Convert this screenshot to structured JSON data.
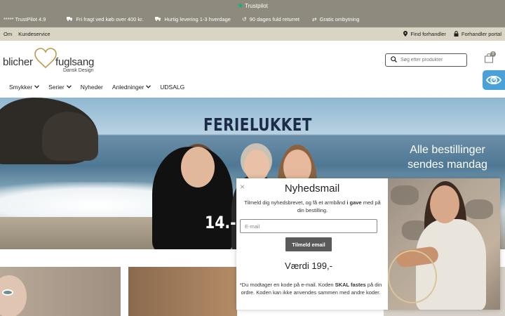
{
  "topbar": {
    "brand": "Trustpilot",
    "star_icon": "star-icon",
    "brand_color": "#00b67a"
  },
  "usp": [
    {
      "icon": "stars",
      "label": "***** TrustPilot 4.9"
    },
    {
      "icon": "truck-icon",
      "label": "Fri fragt ved køb over 400 kr."
    },
    {
      "icon": "delivery-truck-icon",
      "label": "Hurtig levering 1-3 hverdage"
    },
    {
      "icon": "return-icon",
      "label": "90 dages fuld returret"
    },
    {
      "icon": "exchange-icon",
      "label": "Gratis ombytning"
    }
  ],
  "utility": {
    "left": [
      "Om",
      "Kundeservice"
    ],
    "find_dealer": "Find forhandler",
    "dealer_portal": "Forhandler portal"
  },
  "logo": {
    "word1": "blicher",
    "word2": "fuglsang",
    "tagline": "Dansk Design"
  },
  "search": {
    "placeholder": "Søg efter produkter"
  },
  "cart": {
    "count": "0"
  },
  "nav": [
    {
      "label": "Smykker",
      "dropdown": true
    },
    {
      "label": "Serier",
      "dropdown": true
    },
    {
      "label": "Nyheder",
      "dropdown": false
    },
    {
      "label": "Anledninger",
      "dropdown": true
    },
    {
      "label": "UDSALG",
      "dropdown": false
    }
  ],
  "hero": {
    "title": "FERIELUKKET",
    "side_text": "Alle bestillinger sendes mandag",
    "date_text": "14.-3"
  },
  "popup": {
    "close": "×",
    "title": "Nyhedsmail",
    "desc_before": "Tilmeld dig nyhedsbrevet, og få et armbånd ",
    "desc_bold": "i gave",
    "desc_after": " med på din bestilling.",
    "email_placeholder": "E-mail",
    "submit": "Tilmeld email",
    "value": "Værdi 199,-",
    "fine_before": "*Du modtager en kode på e-mail. Koden ",
    "fine_bold": "SKAL fastes",
    "fine_after": " på din ordre. Koden kan ikke anvendes sammen med andre koder."
  },
  "colors": {
    "bar": "#8e8a7d",
    "util": "#d9d4c4",
    "accessibility": "#4aa1d8",
    "hero_title": "#1c2b4a"
  }
}
